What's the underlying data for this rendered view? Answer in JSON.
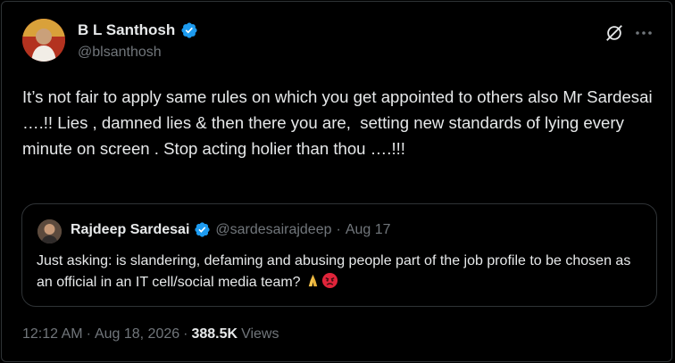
{
  "author": {
    "name": "B L Santhosh",
    "handle": "@blsanthosh"
  },
  "icons": {
    "verified": "verified-badge-icon",
    "grok": "grok-icon",
    "more": "more-options-icon"
  },
  "tweet": {
    "text": "It’s not fair to apply same rules on which you get appointed to others also Mr Sardesai ….!! Lies , damned lies & then there you are,  setting new standards of lying every minute on screen . Stop acting holier than thou ….!!!"
  },
  "quote": {
    "name": "Rajdeep Sardesai",
    "handle": "@sardesairajdeep",
    "separator": "·",
    "date": "Aug 17",
    "text": "Just asking: is slandering, defaming  and abusing people part of the job profile to be chosen as an official in an IT cell/social media team?"
  },
  "meta": {
    "time": "12:12 AM",
    "sep1": "·",
    "date": "Aug 18, 2026",
    "sep2": "·",
    "views_count": "388.5K",
    "views_label": "Views"
  },
  "colors": {
    "background": "#000000",
    "text": "#e7e9ea",
    "muted": "#71767b",
    "border": "#2f3336",
    "verified": "#1d9bf0"
  }
}
